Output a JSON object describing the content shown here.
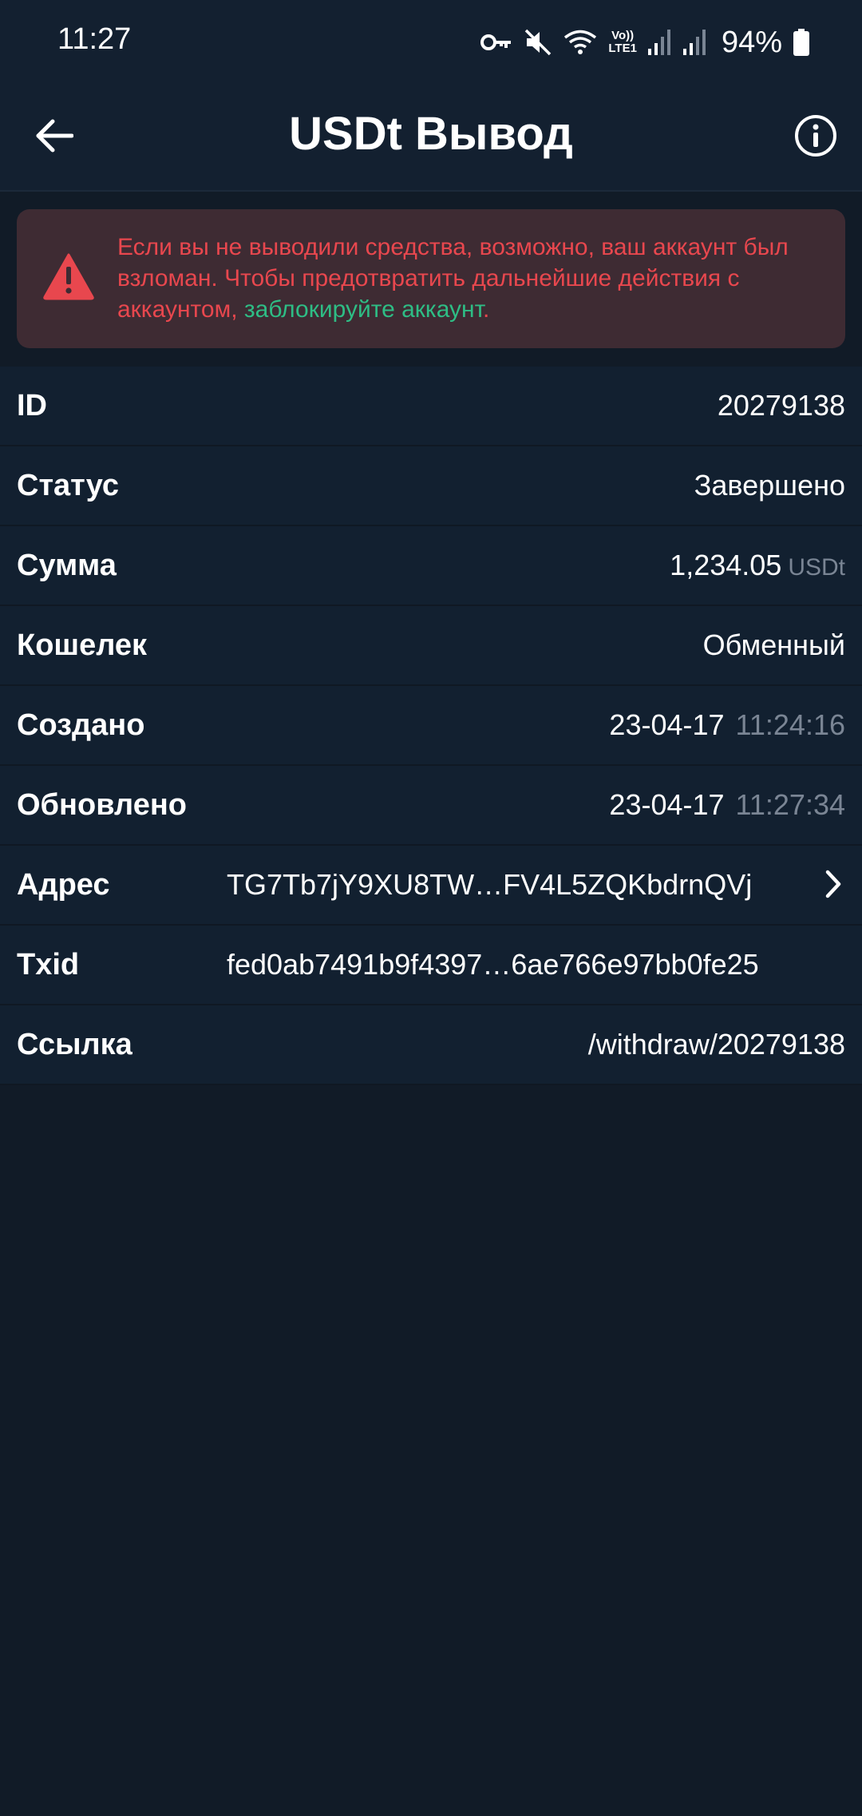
{
  "status_bar": {
    "time": "11:27",
    "network_label_top": "Vo))",
    "network_label_bottom": "LTE1",
    "battery": "94%"
  },
  "header": {
    "title": "USDt Вывод"
  },
  "alert": {
    "text": "Если вы не выводили средства, возможно, ваш аккаунт был взломан. Чтобы предотвратить дальнейшие действия с аккаунтом, ",
    "link": "заблокируйте аккаунт",
    "suffix": "."
  },
  "details": {
    "id_label": "ID",
    "id_value": "20279138",
    "status_label": "Статус",
    "status_value": "Завершено",
    "amount_label": "Сумма",
    "amount_value": "1,234.05",
    "amount_unit": "USDt",
    "wallet_label": "Кошелек",
    "wallet_value": "Обменный",
    "created_label": "Создано",
    "created_date": "23-04-17",
    "created_time": "11:24:16",
    "updated_label": "Обновлено",
    "updated_date": "23-04-17",
    "updated_time": "11:27:34",
    "address_label": "Адрес",
    "address_value": "TG7Tb7jY9XU8TW…FV4L5ZQKbdrnQVj",
    "txid_label": "Txid",
    "txid_value": "fed0ab7491b9f4397…6ae766e97bb0fe25",
    "link_label": "Ссылка",
    "link_value": "/withdraw/20279138"
  },
  "colors": {
    "background": "#111b27",
    "danger": "#e8474e",
    "accent": "#2ebd85",
    "muted": "#7a8594"
  },
  "icons": [
    "back-arrow-icon",
    "info-icon",
    "warning-icon",
    "chevron-right-icon",
    "key-icon",
    "mute-icon",
    "wifi-icon",
    "signal-icon",
    "battery-icon"
  ]
}
